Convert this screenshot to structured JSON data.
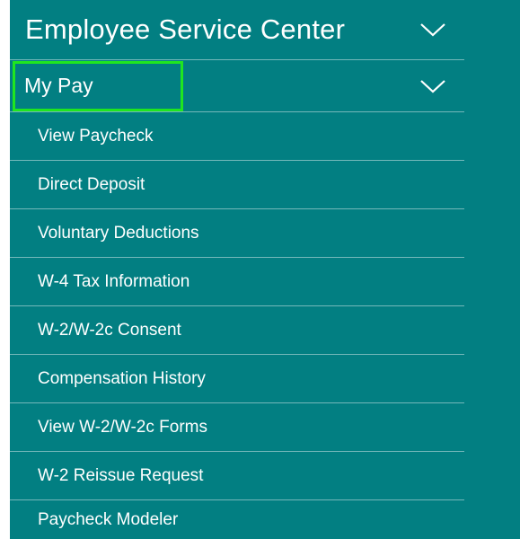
{
  "section": {
    "title": "Employee Service Center",
    "icon": "chevron-down-icon"
  },
  "subsection": {
    "title": "My Pay",
    "icon": "chevron-down-icon",
    "highlight_color": "#1fe61f"
  },
  "colors": {
    "panel_background": "#027f82",
    "text": "#ffffff"
  },
  "menu_items": [
    "View Paycheck",
    "Direct Deposit",
    "Voluntary Deductions",
    "W-4 Tax Information",
    "W-2/W-2c Consent",
    "Compensation History",
    "View W-2/W-2c Forms",
    "W-2 Reissue Request",
    "Paycheck Modeler"
  ]
}
